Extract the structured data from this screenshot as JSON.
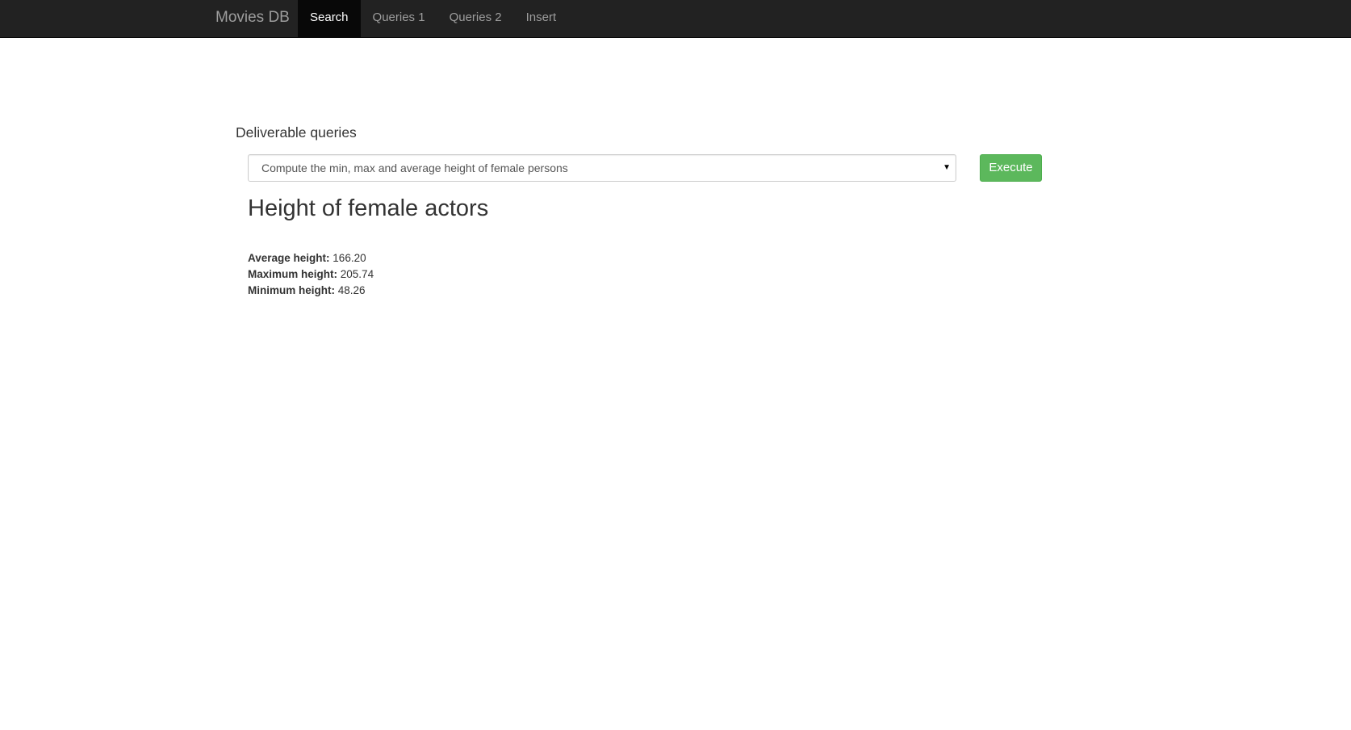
{
  "navbar": {
    "brand": "Movies DB",
    "items": [
      {
        "label": "Search",
        "active": true
      },
      {
        "label": "Queries 1",
        "active": false
      },
      {
        "label": "Queries 2",
        "active": false
      },
      {
        "label": "Insert",
        "active": false
      }
    ],
    "background": "#222222"
  },
  "main": {
    "section_label": "Deliverable queries",
    "query_select": {
      "selected": "Compute the min, max and average height of female persons"
    },
    "execute_label": "Execute",
    "execute_color": "#5cb85c",
    "result": {
      "title": "Height of female actors",
      "stats": [
        {
          "label": "Average height:",
          "value": "166.20"
        },
        {
          "label": "Maximum height:",
          "value": "205.74"
        },
        {
          "label": "Minimum height:",
          "value": "48.26"
        }
      ]
    }
  }
}
